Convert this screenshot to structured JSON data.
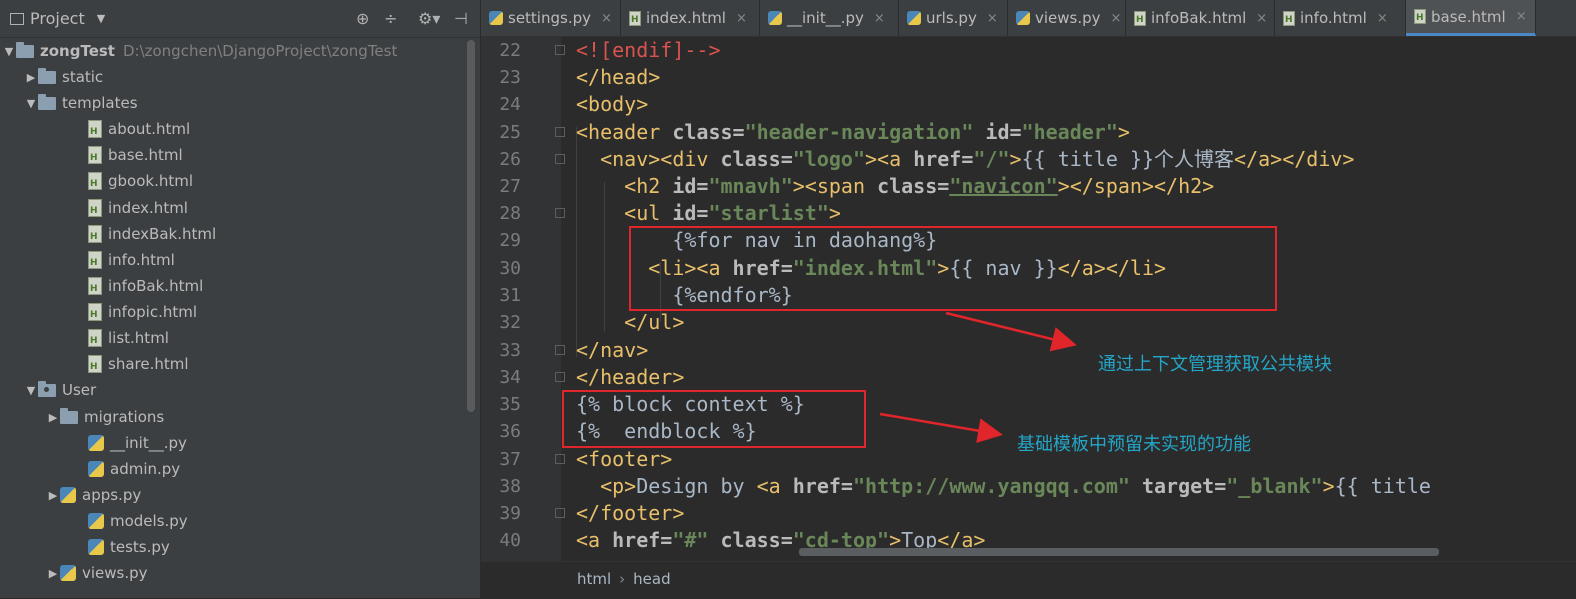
{
  "project_panel": {
    "title": "Project",
    "tree": [
      {
        "label": "zongTest",
        "path": "D:\\zongchen\\DjangoProject\\zongTest",
        "kind": "folder",
        "expanded": true,
        "bold": true
      },
      {
        "label": "static",
        "kind": "folder",
        "expanded": false
      },
      {
        "label": "templates",
        "kind": "folder",
        "expanded": true
      },
      {
        "label": "about.html",
        "kind": "html"
      },
      {
        "label": "base.html",
        "kind": "html"
      },
      {
        "label": "gbook.html",
        "kind": "html"
      },
      {
        "label": "index.html",
        "kind": "html"
      },
      {
        "label": "indexBak.html",
        "kind": "html"
      },
      {
        "label": "info.html",
        "kind": "html"
      },
      {
        "label": "infoBak.html",
        "kind": "html"
      },
      {
        "label": "infopic.html",
        "kind": "html"
      },
      {
        "label": "list.html",
        "kind": "html"
      },
      {
        "label": "share.html",
        "kind": "html"
      },
      {
        "label": "User",
        "kind": "package",
        "expanded": true
      },
      {
        "label": "migrations",
        "kind": "folder",
        "expanded": false
      },
      {
        "label": "__init__.py",
        "kind": "py"
      },
      {
        "label": "admin.py",
        "kind": "py"
      },
      {
        "label": "apps.py",
        "kind": "py",
        "expanded": false
      },
      {
        "label": "models.py",
        "kind": "py"
      },
      {
        "label": "tests.py",
        "kind": "py"
      },
      {
        "label": "views.py",
        "kind": "py",
        "expanded": false
      }
    ]
  },
  "tabs": [
    {
      "label": "settings.py",
      "kind": "py",
      "active": false
    },
    {
      "label": "index.html",
      "kind": "html",
      "active": false
    },
    {
      "label": "__init__.py",
      "kind": "py",
      "active": false
    },
    {
      "label": "urls.py",
      "kind": "py",
      "active": false
    },
    {
      "label": "views.py",
      "kind": "py",
      "active": false
    },
    {
      "label": "infoBak.html",
      "kind": "html",
      "active": false
    },
    {
      "label": "info.html",
      "kind": "html",
      "active": false
    },
    {
      "label": "base.html",
      "kind": "html",
      "active": true
    }
  ],
  "editor": {
    "line_numbers": [
      "22",
      "23",
      "24",
      "25",
      "26",
      "27",
      "28",
      "29",
      "30",
      "31",
      "32",
      "33",
      "34",
      "35",
      "36",
      "37",
      "38",
      "39",
      "40"
    ]
  },
  "breadcrumb": [
    "html",
    "head"
  ],
  "annotations": {
    "note_1": "通过上下文管理获取公共模块",
    "note_2": "基础模板中预留未实现的功能"
  },
  "colors": {
    "arrow_red": "#e0252b",
    "note_blue": "#23a6c8",
    "tag_yellow": "#e8bf6a",
    "string_green": "#6a8759"
  }
}
